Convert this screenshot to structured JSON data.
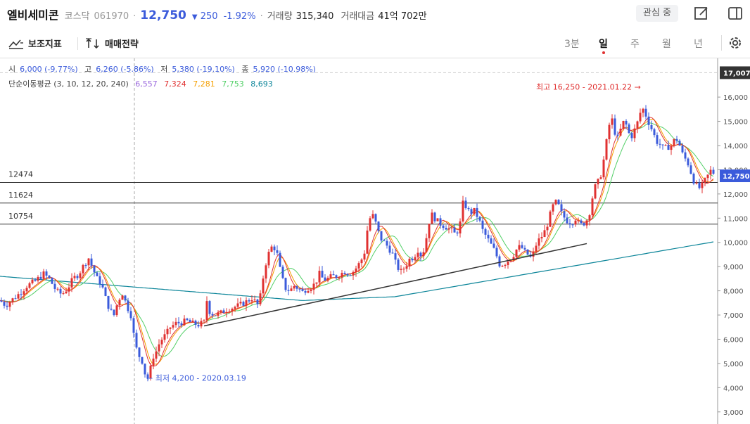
{
  "header": {
    "name": "엘비세미콘",
    "market": "코스닥",
    "code": "061970",
    "price": "12,750",
    "change": "250",
    "change_pct": "-1.92%",
    "volume_label": "거래량",
    "volume": "315,340",
    "amount_label": "거래대금",
    "amount": "41억 702만",
    "favorite_label": "관심 중"
  },
  "toolbar": {
    "indicator_label": "보조지표",
    "strategy_label": "매매전략",
    "timeframes": [
      "3분",
      "일",
      "주",
      "월",
      "년"
    ],
    "active_timeframe": "일"
  },
  "ohlc": {
    "open_label": "시",
    "open": "6,000 (-9.77%)",
    "high_label": "고",
    "high": "6,260 (-5.86%)",
    "low_label": "저",
    "low": "5,380 (-19.10%)",
    "close_label": "종",
    "close": "5,920 (-10.98%)"
  },
  "ma": {
    "label": "단순이동평균 (3, 10, 12, 20, 240)",
    "values": [
      {
        "value": "6,557",
        "color": "#9c6ade"
      },
      {
        "value": "7,324",
        "color": "#e03131"
      },
      {
        "value": "7,281",
        "color": "#f59f00"
      },
      {
        "value": "7,753",
        "color": "#51cf66"
      },
      {
        "value": "8,693",
        "color": "#0c8599"
      }
    ]
  },
  "chart_data": {
    "type": "candlestick",
    "yaxis": {
      "ticks": [
        3000,
        4000,
        5000,
        6000,
        7000,
        8000,
        9000,
        10000,
        11000,
        12000,
        13000,
        14000,
        15000,
        16000
      ],
      "tick_labels": [
        "3,000",
        "4,000",
        "5,000",
        "6,000",
        "7,000",
        "8,000",
        "9,000",
        "10,000",
        "11,000",
        "12,000",
        "13,000",
        "14,000",
        "15,000",
        "16,000"
      ],
      "range": [
        2500,
        17600
      ]
    },
    "top_marker": {
      "value": 17007,
      "label": "17,007"
    },
    "current_marker": {
      "value": 12750,
      "label": "12,750"
    },
    "h_lines": [
      {
        "value": 12474,
        "label": "12474"
      },
      {
        "value": 11624,
        "label": "11624"
      },
      {
        "value": 10754,
        "label": "10754"
      }
    ],
    "high_annotation": {
      "label": "최고 16,250 - 2021.01.22 →",
      "value": 16250
    },
    "low_annotation": {
      "label": "← 최저 4,200 - 2020.03.19",
      "value": 4200
    },
    "trendline": {
      "from": 6550,
      "to": 9950
    },
    "price_path": [
      [
        0,
        7600
      ],
      [
        8,
        7400
      ],
      [
        14,
        7550
      ],
      [
        20,
        7700
      ],
      [
        28,
        7900
      ],
      [
        38,
        8200
      ],
      [
        50,
        8400
      ],
      [
        62,
        8700
      ],
      [
        70,
        8500
      ],
      [
        80,
        8000
      ],
      [
        88,
        7850
      ],
      [
        96,
        8100
      ],
      [
        104,
        8500
      ],
      [
        112,
        8700
      ],
      [
        120,
        9100
      ],
      [
        126,
        9350
      ],
      [
        132,
        8900
      ],
      [
        138,
        8500
      ],
      [
        144,
        8300
      ],
      [
        150,
        7700
      ],
      [
        156,
        7200
      ],
      [
        162,
        7000
      ],
      [
        168,
        7600
      ],
      [
        174,
        7900
      ],
      [
        180,
        7400
      ],
      [
        186,
        7000
      ],
      [
        190,
        6200
      ],
      [
        194,
        5600
      ],
      [
        198,
        5300
      ],
      [
        202,
        5100
      ],
      [
        206,
        4600
      ],
      [
        210,
        4400
      ],
      [
        214,
        4800
      ],
      [
        218,
        5300
      ],
      [
        222,
        5500
      ],
      [
        226,
        5800
      ],
      [
        230,
        6000
      ],
      [
        236,
        6200
      ],
      [
        242,
        6500
      ],
      [
        250,
        6650
      ],
      [
        258,
        6700
      ],
      [
        266,
        6750
      ],
      [
        274,
        6650
      ],
      [
        282,
        6600
      ],
      [
        290,
        6700
      ],
      [
        294,
        7600
      ],
      [
        298,
        7150
      ],
      [
        304,
        7000
      ],
      [
        312,
        7050
      ],
      [
        320,
        7200
      ],
      [
        330,
        7300
      ],
      [
        340,
        7400
      ],
      [
        350,
        7550
      ],
      [
        358,
        7700
      ],
      [
        364,
        7500
      ],
      [
        368,
        7350
      ],
      [
        372,
        8200
      ],
      [
        376,
        8900
      ],
      [
        380,
        9400
      ],
      [
        384,
        9700
      ],
      [
        388,
        9900
      ],
      [
        394,
        9500
      ],
      [
        400,
        8600
      ],
      [
        406,
        8100
      ],
      [
        412,
        8000
      ],
      [
        418,
        8200
      ],
      [
        424,
        8100
      ],
      [
        430,
        7950
      ],
      [
        436,
        8100
      ],
      [
        442,
        8150
      ],
      [
        448,
        8300
      ],
      [
        454,
        8700
      ],
      [
        460,
        8450
      ],
      [
        466,
        8500
      ],
      [
        472,
        8600
      ],
      [
        478,
        8600
      ],
      [
        484,
        8700
      ],
      [
        490,
        8800
      ],
      [
        496,
        8700
      ],
      [
        502,
        8800
      ],
      [
        508,
        9000
      ],
      [
        514,
        9300
      ],
      [
        518,
        9600
      ],
      [
        522,
        10500
      ],
      [
        526,
        11000
      ],
      [
        530,
        11100
      ],
      [
        534,
        10800
      ],
      [
        540,
        10200
      ],
      [
        546,
        10000
      ],
      [
        552,
        9800
      ],
      [
        558,
        9500
      ],
      [
        564,
        9000
      ],
      [
        570,
        8800
      ],
      [
        576,
        9000
      ],
      [
        582,
        9300
      ],
      [
        588,
        9400
      ],
      [
        594,
        9700
      ],
      [
        600,
        9400
      ],
      [
        606,
        10200
      ],
      [
        612,
        11200
      ],
      [
        618,
        11000
      ],
      [
        624,
        10800
      ],
      [
        630,
        10700
      ],
      [
        636,
        10600
      ],
      [
        642,
        10500
      ],
      [
        648,
        10300
      ],
      [
        654,
        10800
      ],
      [
        658,
        11600
      ],
      [
        662,
        11500
      ],
      [
        668,
        11200
      ],
      [
        674,
        11300
      ],
      [
        680,
        11000
      ],
      [
        686,
        10500
      ],
      [
        692,
        10200
      ],
      [
        698,
        9900
      ],
      [
        704,
        9600
      ],
      [
        710,
        9100
      ],
      [
        716,
        9100
      ],
      [
        722,
        9250
      ],
      [
        728,
        9400
      ],
      [
        734,
        9700
      ],
      [
        740,
        9850
      ],
      [
        746,
        9600
      ],
      [
        752,
        9450
      ],
      [
        756,
        9300
      ],
      [
        760,
        9800
      ],
      [
        764,
        10000
      ],
      [
        768,
        10200
      ],
      [
        772,
        10300
      ],
      [
        776,
        10600
      ],
      [
        780,
        10900
      ],
      [
        784,
        11400
      ],
      [
        788,
        11600
      ],
      [
        792,
        11700
      ],
      [
        796,
        11300
      ],
      [
        800,
        11100
      ],
      [
        806,
        10900
      ],
      [
        812,
        10800
      ],
      [
        818,
        11000
      ],
      [
        824,
        10700
      ],
      [
        830,
        10800
      ],
      [
        836,
        11000
      ],
      [
        840,
        11500
      ],
      [
        844,
        12200
      ],
      [
        848,
        12400
      ],
      [
        852,
        12600
      ],
      [
        856,
        13000
      ],
      [
        860,
        13800
      ],
      [
        864,
        14500
      ],
      [
        868,
        15200
      ],
      [
        872,
        14900
      ],
      [
        876,
        14200
      ],
      [
        880,
        14400
      ],
      [
        884,
        14900
      ],
      [
        888,
        15000
      ],
      [
        892,
        14700
      ],
      [
        896,
        14300
      ],
      [
        900,
        14500
      ],
      [
        904,
        14800
      ],
      [
        908,
        15100
      ],
      [
        912,
        15600
      ],
      [
        916,
        15400
      ],
      [
        920,
        15100
      ],
      [
        924,
        14800
      ],
      [
        928,
        14600
      ],
      [
        932,
        14200
      ],
      [
        936,
        14100
      ],
      [
        940,
        14000
      ],
      [
        944,
        13800
      ],
      [
        948,
        14000
      ],
      [
        952,
        13900
      ],
      [
        956,
        14100
      ],
      [
        960,
        14300
      ],
      [
        964,
        14200
      ],
      [
        968,
        13800
      ],
      [
        972,
        13500
      ],
      [
        976,
        13400
      ],
      [
        980,
        13100
      ],
      [
        984,
        12700
      ],
      [
        988,
        12400
      ],
      [
        992,
        12300
      ],
      [
        996,
        12200
      ],
      [
        1000,
        12500
      ],
      [
        1004,
        12600
      ],
      [
        1008,
        12900
      ],
      [
        1012,
        13000
      ],
      [
        1016,
        12750
      ]
    ]
  }
}
